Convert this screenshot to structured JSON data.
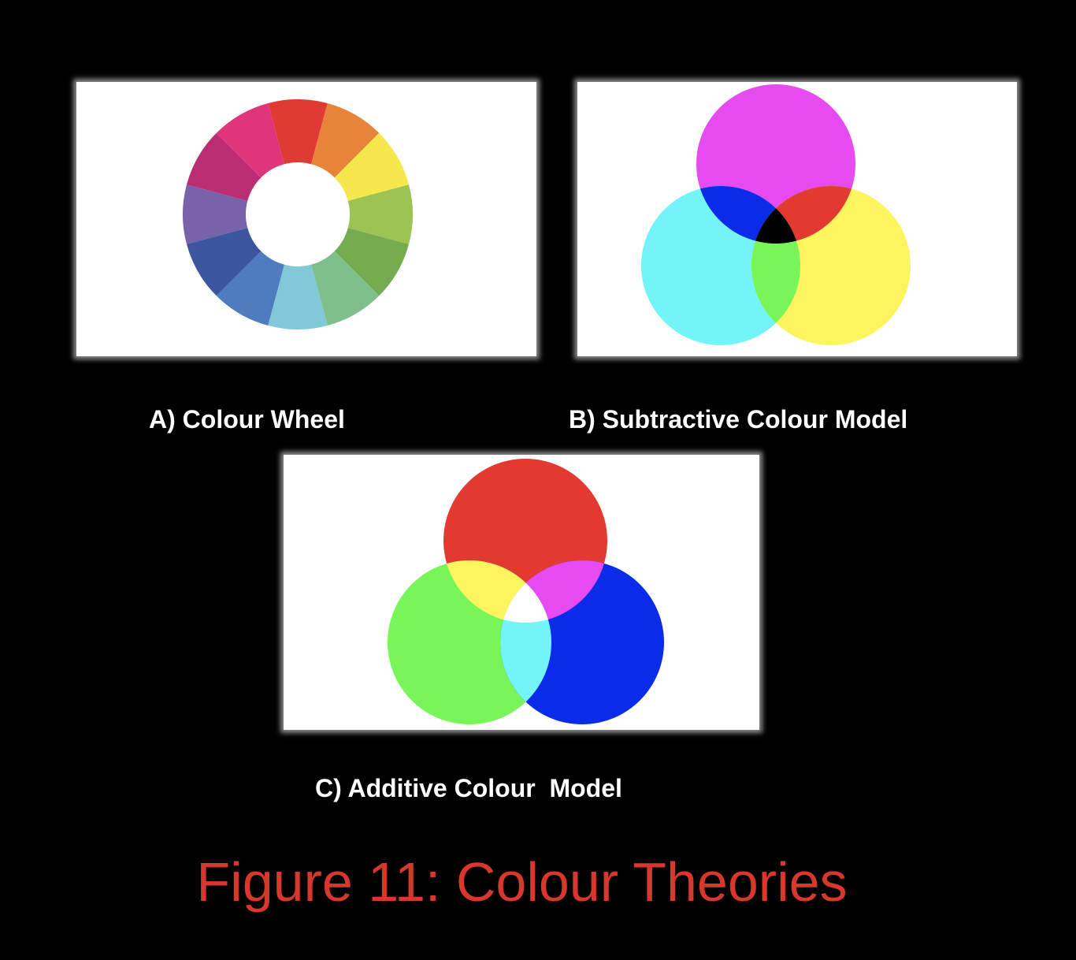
{
  "captions": {
    "a": "A) Colour Wheel",
    "b": "B) Subtractive Colour Model",
    "c": "C) Additive Colour  Model"
  },
  "figure_title": "Figure 11: Colour Theories",
  "colors": {
    "background": "#000000",
    "panel": "#ffffff",
    "caption_text": "#ffffff",
    "figure_title_text": "#d8372b"
  },
  "colour_wheel": {
    "segments": [
      "#e03a35",
      "#e8843a",
      "#f5e84d",
      "#9dc453",
      "#76ab4f",
      "#7ebf8c",
      "#83c8d6",
      "#4e7cbe",
      "#3b559e",
      "#7862a8",
      "#ba2d72",
      "#e0357a"
    ]
  },
  "subtractive_model": {
    "circles": [
      {
        "name": "magenta",
        "color": "#e54bf0"
      },
      {
        "name": "cyan",
        "color": "#73f4f8"
      },
      {
        "name": "yellow",
        "color": "#fdf55e"
      }
    ],
    "overlaps": {
      "magenta_cyan": "#0a2be8",
      "magenta_yellow": "#e23a30",
      "cyan_yellow": "#78f558",
      "all": "#000000"
    }
  },
  "additive_model": {
    "circles": [
      {
        "name": "red",
        "color": "#e23a30"
      },
      {
        "name": "green",
        "color": "#78f558"
      },
      {
        "name": "blue",
        "color": "#0a2be8"
      }
    ],
    "overlaps": {
      "red_green": "#fdf55e",
      "red_blue": "#e54bf0",
      "green_blue": "#73f4f8",
      "all": "#ffffff"
    }
  }
}
